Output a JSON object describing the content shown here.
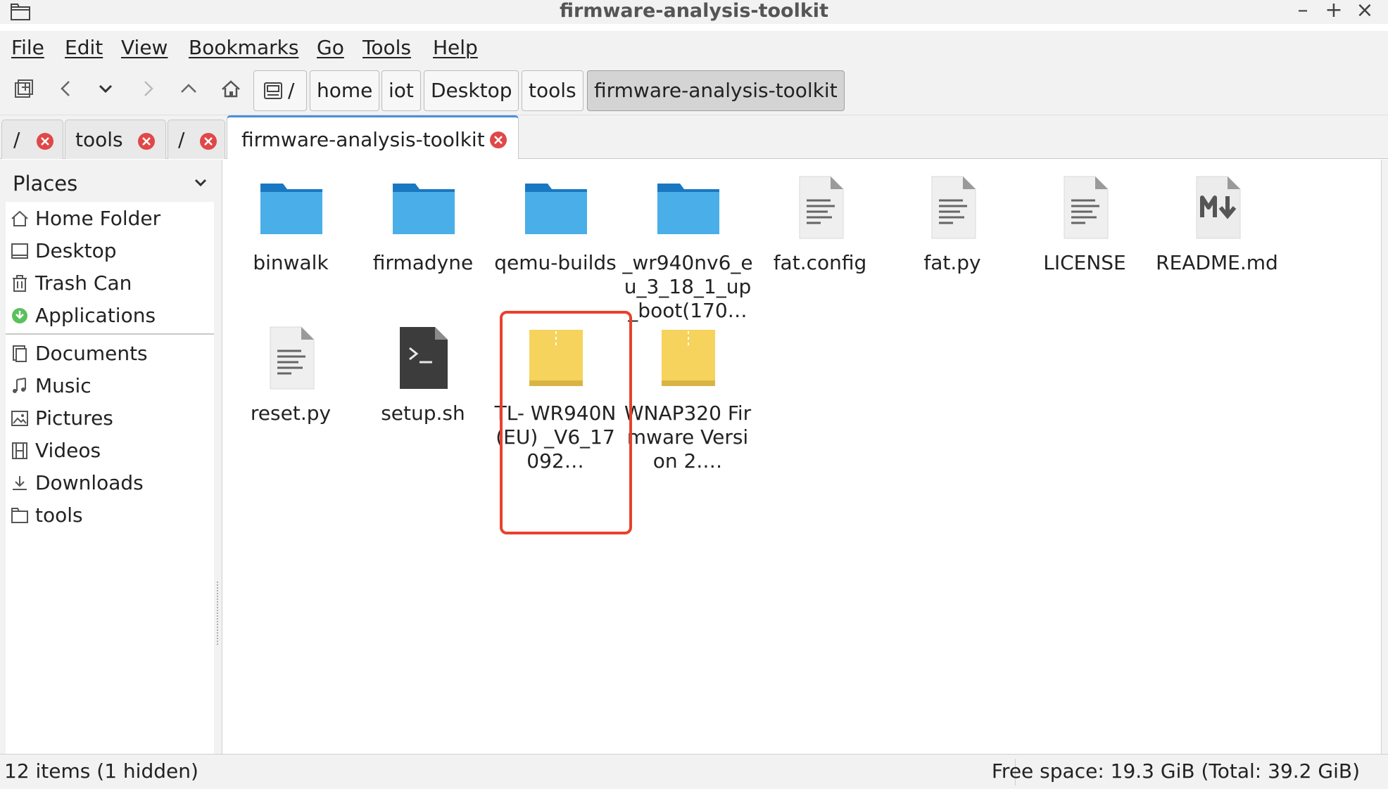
{
  "window": {
    "title": "firmware-analysis-toolkit",
    "controls": {
      "minimize": "–",
      "maximize": "+",
      "close": "×"
    }
  },
  "menu": {
    "file": "File",
    "edit": "Edit",
    "view": "View",
    "bookmarks": "Bookmarks",
    "go": "Go",
    "tools": "Tools",
    "help": "Help"
  },
  "toolbar": {
    "icons": [
      "new-tab-icon",
      "back-icon",
      "history-dropdown-icon",
      "forward-icon",
      "up-icon",
      "home-icon"
    ]
  },
  "path": {
    "root": "/",
    "segments": [
      "home",
      "iot",
      "Desktop",
      "tools",
      "firmware-analysis-toolkit"
    ],
    "active_index": 4
  },
  "tabs": [
    {
      "label": "/",
      "active": false
    },
    {
      "label": "tools",
      "active": false
    },
    {
      "label": "/",
      "active": false
    },
    {
      "label": "firmware-analysis-toolkit",
      "active": true
    }
  ],
  "sidebar": {
    "header": "Places",
    "items": [
      {
        "label": "Home Folder",
        "icon": "home-icon"
      },
      {
        "label": "Desktop",
        "icon": "desktop-icon"
      },
      {
        "label": "Trash Can",
        "icon": "trash-icon"
      },
      {
        "label": "Applications",
        "icon": "applications-icon"
      },
      {
        "label": "Documents",
        "icon": "documents-icon"
      },
      {
        "label": "Music",
        "icon": "music-icon"
      },
      {
        "label": "Pictures",
        "icon": "pictures-icon"
      },
      {
        "label": "Videos",
        "icon": "videos-icon"
      },
      {
        "label": "Downloads",
        "icon": "downloads-icon"
      },
      {
        "label": "tools",
        "icon": "folder-icon"
      }
    ]
  },
  "files": [
    {
      "name": "binwalk",
      "type": "folder"
    },
    {
      "name": "firmadyne",
      "type": "folder"
    },
    {
      "name": "qemu-builds",
      "type": "folder"
    },
    {
      "name": "_wr940nv6_e u_3_18_1_up _boot(170…",
      "type": "folder"
    },
    {
      "name": "fat.config",
      "type": "text"
    },
    {
      "name": "fat.py",
      "type": "text"
    },
    {
      "name": "LICENSE",
      "type": "text"
    },
    {
      "name": "README.md",
      "type": "markdown"
    },
    {
      "name": "reset.py",
      "type": "text"
    },
    {
      "name": "setup.sh",
      "type": "script"
    },
    {
      "name": "TL- WR940N(EU) _V6_17092…",
      "type": "archive",
      "highlighted": true
    },
    {
      "name": "WNAP320 Firmware Version 2.…",
      "type": "archive"
    }
  ],
  "status": {
    "left": "12 items (1 hidden)",
    "right": "Free space: 19.3 GiB (Total: 39.2 GiB)"
  },
  "colors": {
    "folder": "#4aaee8",
    "folder_tab": "#1a78c2",
    "archive": "#f5d35c",
    "highlight": "#e8412c",
    "tab_accent": "#4a90d9"
  }
}
